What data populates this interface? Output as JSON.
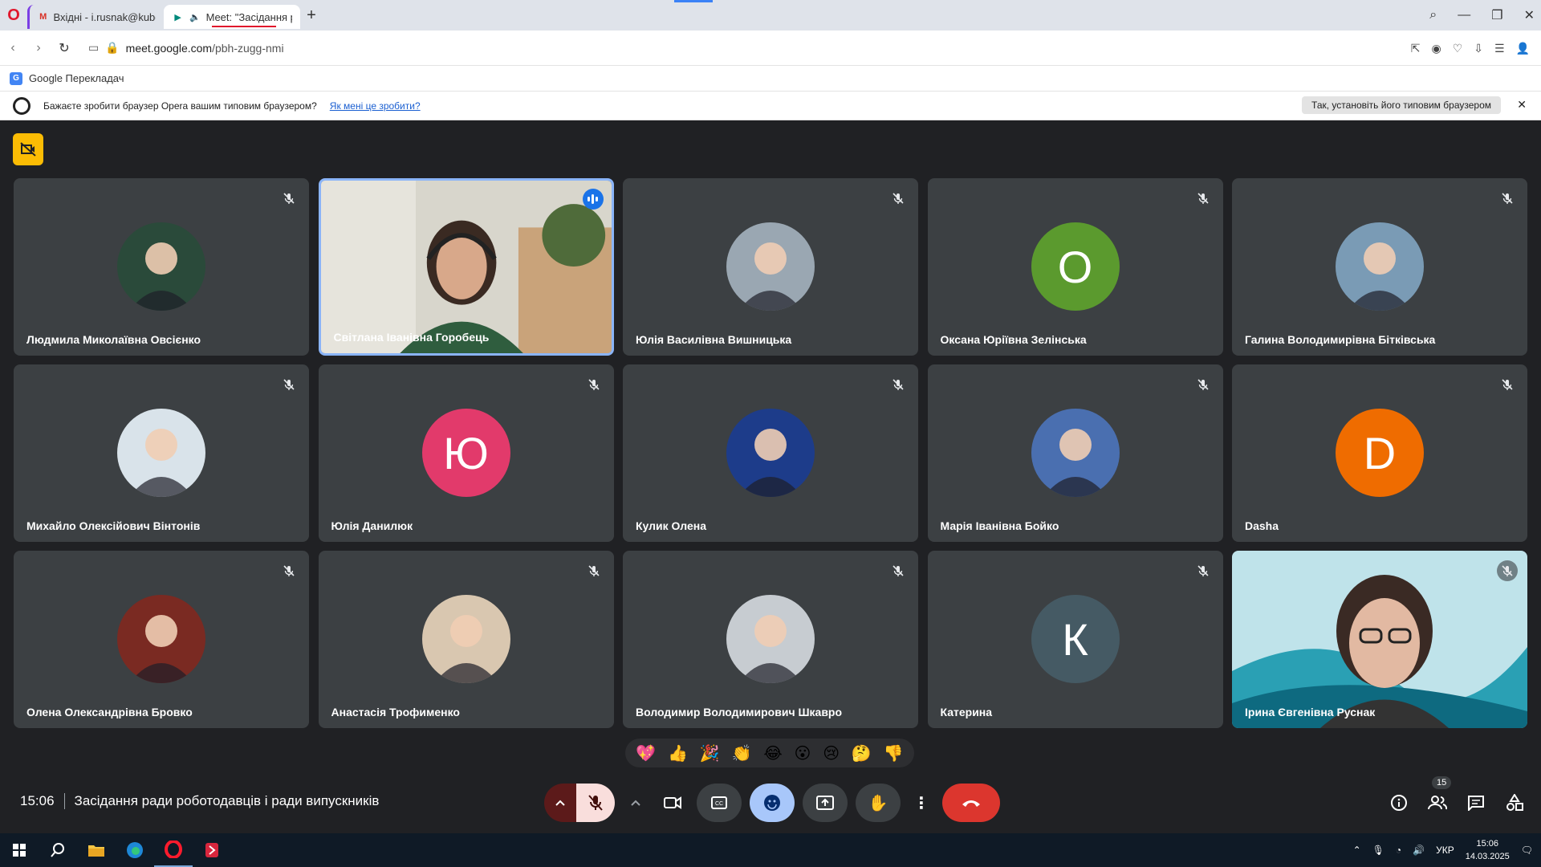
{
  "browser": {
    "tabs": [
      {
        "label": "Вхідні - i.rusnak@kubg.ec",
        "icon": "gmail-icon"
      },
      {
        "label": "Meet: \"Засідання р",
        "icon": "meet-icon"
      }
    ],
    "url_domain": "meet.google.com",
    "url_path": "/pbh-zugg-nmi",
    "bookmark": "Google Перекладач",
    "infobar_text": "Бажаєте зробити браузер Opera вашим типовим браузером?",
    "infobar_link": "Як мені це зробити?",
    "infobar_button": "Так, установіть його типовим браузером"
  },
  "participants": [
    {
      "name": "Людмила Миколаївна Овсієнко",
      "type": "photo",
      "color": "#2a4a3a"
    },
    {
      "name": "Світлана Іванівна Горобець",
      "type": "video",
      "speaking": true
    },
    {
      "name": "Юлія Василівна Вишницька",
      "type": "photo",
      "color": "#9aa7b2"
    },
    {
      "name": "Оксана Юріївна Зелінська",
      "type": "letter",
      "letter": "О",
      "color": "#5b9a2e"
    },
    {
      "name": "Галина Володимирівна Бітківська",
      "type": "photo",
      "color": "#7a9bb5"
    },
    {
      "name": "Михайло Олексійович Вінтонів",
      "type": "photo",
      "color": "#d9e3ea"
    },
    {
      "name": "Юлія Данилюк",
      "type": "letter",
      "letter": "Ю",
      "color": "#e23a6b"
    },
    {
      "name": "Кулик Олена",
      "type": "photo",
      "color": "#1d3c8a"
    },
    {
      "name": "Марія Іванівна Бойко",
      "type": "photo",
      "color": "#4a6fb0"
    },
    {
      "name": "Dasha",
      "type": "letter",
      "letter": "D",
      "color": "#ef6c00"
    },
    {
      "name": "Олена Олександрівна Бровко",
      "type": "photo",
      "color": "#7a2a22"
    },
    {
      "name": "Анастасія Трофименко",
      "type": "photo",
      "color": "#d9c7b0"
    },
    {
      "name": "Володимир Володимирович Шкавро",
      "type": "photo",
      "color": "#c7ccd1"
    },
    {
      "name": "Катерина",
      "type": "letter",
      "letter": "К",
      "color": "#455a64"
    },
    {
      "name": "Ірина Євгенівна Руснак",
      "type": "video2",
      "speaking": false
    }
  ],
  "reactions": [
    "💖",
    "👍",
    "🎉",
    "👏",
    "😂",
    "😮",
    "😢",
    "🤔",
    "👎"
  ],
  "meeting": {
    "time": "15:06",
    "title": "Засідання ради роботодавців і ради випускників",
    "people_count": "15"
  },
  "taskbar": {
    "lang": "УКР",
    "time": "15:06",
    "date": "14.03.2025"
  }
}
